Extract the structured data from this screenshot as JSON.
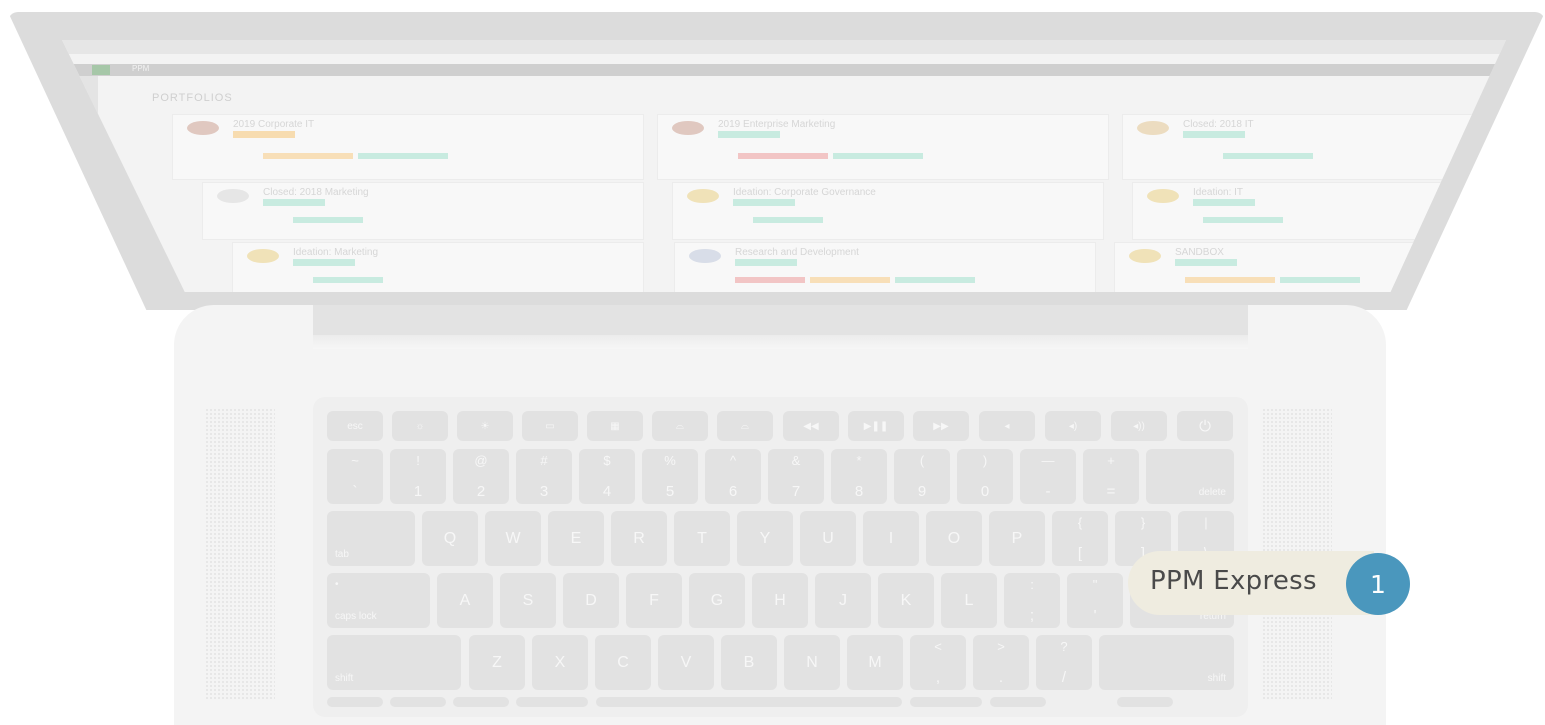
{
  "callout": {
    "label": "PPM Express",
    "number": "1"
  },
  "screen": {
    "app_name": "PPM",
    "page_title": "PORTFOLIOS",
    "cards": [
      {
        "title": "2019 Corporate IT"
      },
      {
        "title": "2019 Enterprise Marketing"
      },
      {
        "title": "Closed: 2018 IT"
      },
      {
        "title": "Closed: 2018 Marketing"
      },
      {
        "title": "Ideation: Corporate Governance"
      },
      {
        "title": "Ideation: IT"
      },
      {
        "title": "Ideation: Marketing"
      },
      {
        "title": "Research and Development"
      },
      {
        "title": "SANDBOX"
      }
    ]
  },
  "keyboard": {
    "function_row": [
      "esc",
      "",
      "",
      "",
      "",
      "",
      "",
      "",
      "",
      "",
      "",
      "",
      "",
      "",
      "⏻"
    ],
    "number_row": [
      {
        "top": "~",
        "bot": "`"
      },
      {
        "top": "!",
        "bot": "1"
      },
      {
        "top": "@",
        "bot": "2"
      },
      {
        "top": "#",
        "bot": "3"
      },
      {
        "top": "$",
        "bot": "4"
      },
      {
        "top": "%",
        "bot": "5"
      },
      {
        "top": "^",
        "bot": "6"
      },
      {
        "top": "&",
        "bot": "7"
      },
      {
        "top": "*",
        "bot": "8"
      },
      {
        "top": "(",
        "bot": "9"
      },
      {
        "top": ")",
        "bot": "0"
      },
      {
        "top": "—",
        "bot": "-"
      },
      {
        "top": "+",
        "bot": "="
      }
    ],
    "delete": "delete",
    "tab": "tab",
    "qwerty_row": [
      "Q",
      "W",
      "E",
      "R",
      "T",
      "Y",
      "U",
      "I",
      "O",
      "P"
    ],
    "bracket_keys": [
      {
        "top": "{",
        "bot": "["
      },
      {
        "top": "}",
        "bot": "]"
      },
      {
        "top": "|",
        "bot": "\\"
      }
    ],
    "caps_lock": "caps lock",
    "home_row": [
      "A",
      "S",
      "D",
      "F",
      "G",
      "H",
      "J",
      "K",
      "L"
    ],
    "semicolon": {
      "top": ":",
      "bot": ";"
    },
    "quote": {
      "top": "\"",
      "bot": "'"
    },
    "return": "return",
    "shift": "shift",
    "bottom_row": [
      "Z",
      "X",
      "C",
      "V",
      "B",
      "N",
      "M"
    ],
    "comma": {
      "top": "<",
      "bot": ","
    },
    "period": {
      "top": ">",
      "bot": "."
    },
    "slash": {
      "top": "?",
      "bot": "/"
    }
  },
  "colors": {
    "callout_marker": "#4a97bd",
    "callout_background": "#efece0",
    "key_face": "#e2e2e2"
  }
}
